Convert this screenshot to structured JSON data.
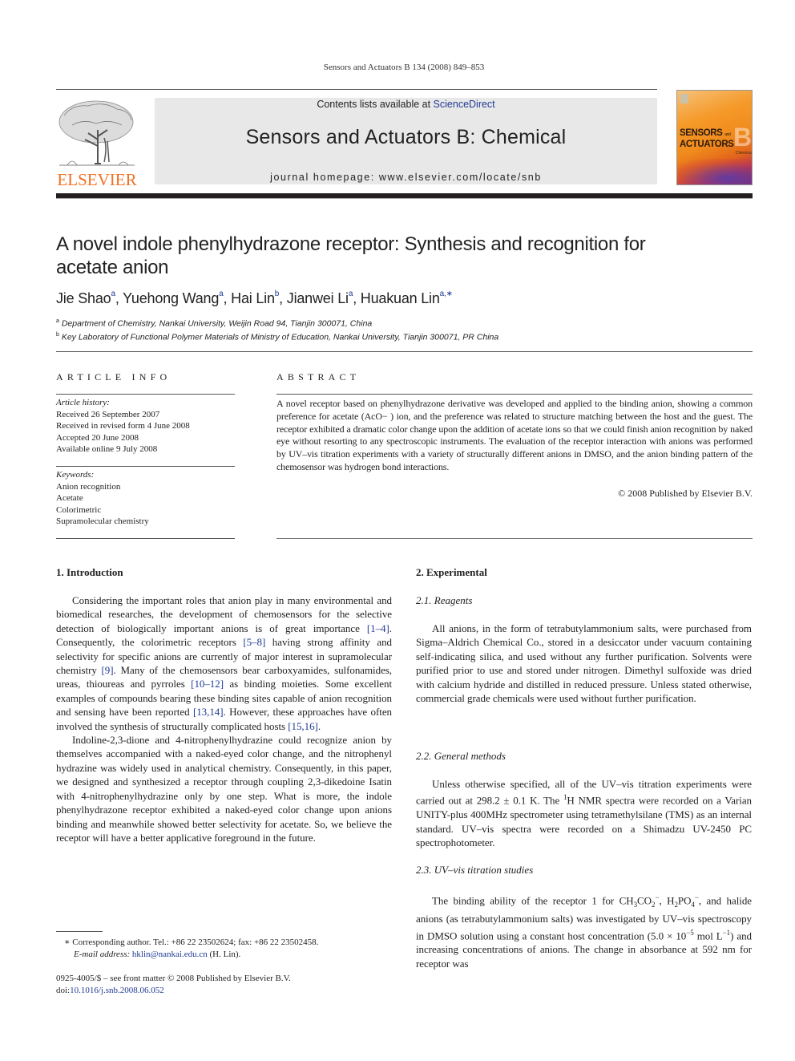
{
  "running_head": "Sensors and Actuators B 134 (2008) 849–853",
  "masthead": {
    "publisher_wordmark": "ELSEVIER",
    "contents_prefix": "Contents lists available at ",
    "contents_link": "ScienceDirect",
    "journal_title": "Sensors and Actuators B: Chemical",
    "homepage": "journal homepage: www.elsevier.com/locate/snb",
    "cover": {
      "line1": "SENSORS",
      "line2": "ACTUATORS",
      "letter": "B",
      "small": "and",
      "sub": "Chemical"
    },
    "colors": {
      "elsevier_orange": "#f37021",
      "link_blue": "#1f3a93",
      "masthead_gray": "#e8e8e8"
    }
  },
  "article": {
    "title": "A novel indole phenylhydrazone receptor: Synthesis and recognition for acetate anion",
    "authors": [
      {
        "name": "Jie Shao",
        "aff": "a"
      },
      {
        "name": "Yuehong Wang",
        "aff": "a"
      },
      {
        "name": "Hai Lin",
        "aff": "b"
      },
      {
        "name": "Jianwei Li",
        "aff": "a"
      },
      {
        "name": "Huakuan Lin",
        "aff": "a,∗"
      }
    ],
    "affiliations": [
      {
        "mark": "a",
        "text": "Department of Chemistry, Nankai University, Weijin Road 94, Tianjin 300071, China"
      },
      {
        "mark": "b",
        "text": "Key Laboratory of Functional Polymer Materials of Ministry of Education, Nankai University, Tianjin 300071, PR China"
      }
    ]
  },
  "article_info": {
    "heading": "ARTICLE INFO",
    "history_label": "Article history:",
    "history": [
      "Received 26 September 2007",
      "Received in revised form 4 June 2008",
      "Accepted 20 June 2008",
      "Available online 9 July 2008"
    ],
    "keywords_label": "Keywords:",
    "keywords": [
      "Anion recognition",
      "Acetate",
      "Colorimetric",
      "Supramolecular chemistry"
    ]
  },
  "abstract": {
    "heading": "ABSTRACT",
    "text": "A novel receptor based on phenylhydrazone derivative was developed and applied to the binding anion, showing a common preference for acetate (AcO− ) ion, and the preference was related to structure matching between the host and the guest. The receptor exhibited a dramatic color change upon the addition of acetate ions so that we could finish anion recognition by naked eye without resorting to any spectroscopic instruments. The evaluation of the receptor interaction with anions was performed by UV–vis titration experiments with a variety of structurally different anions in DMSO, and the anion binding pattern of the chemosensor was hydrogen bond interactions.",
    "copyright": "© 2008 Published by Elsevier B.V."
  },
  "introduction": {
    "heading": "1.  Introduction",
    "p1": [
      {
        "t": "Considering the important roles that anion play in many environmental and biomedical researches, the development of chemosensors for the selective detection of biologically important anions is of great importance "
      },
      {
        "ref": "[1–4]"
      },
      {
        "t": ". Consequently, the colorimetric receptors "
      },
      {
        "ref": "[5–8]"
      },
      {
        "t": " having strong affinity and selectivity for specific anions are currently of major interest in supramolecular chemistry "
      },
      {
        "ref": "[9]"
      },
      {
        "t": ". Many of the chemosensors bear carboxyamides, sulfonamides, ureas, thioureas and pyrroles "
      },
      {
        "ref": "[10–12]"
      },
      {
        "t": " as binding moieties. Some excellent examples of compounds bearing these binding sites capable of anion recognition and sensing have been reported "
      },
      {
        "ref": "[13,14]"
      },
      {
        "t": ". However, these approaches have often involved the synthesis of structurally complicated hosts "
      },
      {
        "ref": "[15,16]"
      },
      {
        "t": "."
      }
    ],
    "p2": "Indoline-2,3-dione and 4-nitrophenylhydrazine could recognize anion by themselves accompanied with a naked-eyed color change, and the nitrophenyl hydrazine was widely used in analytical chemistry. Consequently, in this paper, we designed and synthesized a receptor through coupling 2,3-dikedoine Isatin with 4-nitrophenylhydrazine only by one step. What is more, the indole phenylhydrazone receptor exhibited a naked-eyed color change upon anions binding and meanwhile showed better selectivity for acetate. So, we believe the receptor will have a better applicative foreground in the future."
  },
  "experimental": {
    "heading": "2.  Experimental",
    "reagents": {
      "heading": "2.1.  Reagents",
      "text": "All anions, in the form of tetrabutylammonium salts, were purchased from Sigma–Aldrich Chemical Co., stored in a desiccator under vacuum containing self-indicating silica, and used without any further purification. Solvents were purified prior to use and stored under nitrogen. Dimethyl sulfoxide was dried with calcium hydride and distilled in reduced pressure. Unless stated otherwise, commercial grade chemicals were used without further purification."
    },
    "methods": {
      "heading": "2.2.  General methods",
      "text_a": "Unless otherwise specified, all of the UV–vis titration experiments were carried out at 298.2 ± 0.1 K. The ",
      "sup": "1",
      "text_b": "H NMR spectra were recorded on a Varian UNITY-plus 400MHz spectrometer using tetramethylsilane (TMS) as an internal standard. UV–vis spectra were recorded on a Shimadzu UV-2450 PC spectrophotometer."
    },
    "uvvis": {
      "heading": "2.3.  UV–vis titration studies",
      "t1": "The binding ability of the receptor 1 for CH",
      "s1": "3",
      "t2": "CO",
      "s2": "2",
      "u1": "−",
      "t3": ", H",
      "s3": "2",
      "t4": "PO",
      "s4": "4",
      "u2": "−",
      "t5": ", and halide anions (as tetrabutylammonium salts) was investigated by UV–vis spectroscopy in DMSO solution using a constant host concentration (5.0 × 10",
      "u3": "−5",
      "t6": " mol L",
      "u4": "−1",
      "t7": ") and increasing concentrations of anions. The change in absorbance at 592 nm for receptor was"
    }
  },
  "footnotes": {
    "corresponding": "∗  Corresponding author. Tel.: +86 22 23502624; fax: +86 22 23502458.",
    "email_label": "E-mail address:",
    "email": "hklin@nankai.edu.cn",
    "email_suffix": " (H. Lin).",
    "front_matter": "0925-4005/$ – see front matter © 2008 Published by Elsevier B.V.",
    "doi_prefix": "doi:",
    "doi": "10.1016/j.snb.2008.06.052"
  }
}
